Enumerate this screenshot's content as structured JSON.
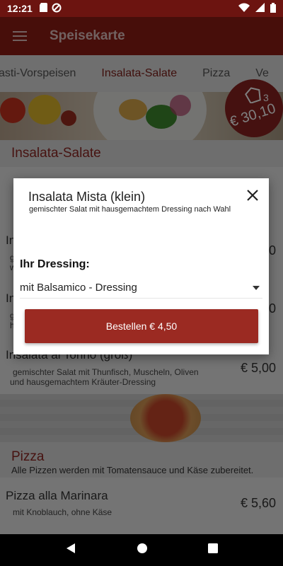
{
  "status": {
    "time": "12:21"
  },
  "appbar": {
    "title": "Speisekarte"
  },
  "tabs": [
    {
      "label": "asti-Vorspeisen"
    },
    {
      "label": "Insalata-Salate"
    },
    {
      "label": "Pizza"
    },
    {
      "label": "Ve"
    }
  ],
  "cart": {
    "count": "3",
    "total": "€ 30,10"
  },
  "section": {
    "title": "Insalata-Salate"
  },
  "items": [
    {
      "name": "In",
      "desc1": "g",
      "desc2": "w",
      "price": "0"
    },
    {
      "name": "In",
      "desc1": "g",
      "desc2": "h",
      "price": "0"
    },
    {
      "name": "Insalata al Tonno (groß)",
      "desc1": "gemischter Salat mit Thunfisch, Muscheln, Oliven",
      "desc2": "und hausgemachtem Kräuter-Dressing",
      "price": "€ 5,00"
    }
  ],
  "pizza_section": {
    "title": "Pizza",
    "subtitle": "Alle Pizzen werden mit Tomatensauce und Käse zubereitet."
  },
  "pizza_item": {
    "name": "Pizza alla Marinara",
    "desc": "mit Knoblauch, ohne Käse",
    "price": "€ 5,60"
  },
  "dialog": {
    "title": "Insalata Mista (klein)",
    "subtitle": "gemischter Salat mit hausgemachtem Dressing nach Wahl",
    "dressing_label": "Ihr Dressing:",
    "dressing_value": "mit Balsamico - Dressing",
    "order_label": "Bestellen € 4,50"
  }
}
